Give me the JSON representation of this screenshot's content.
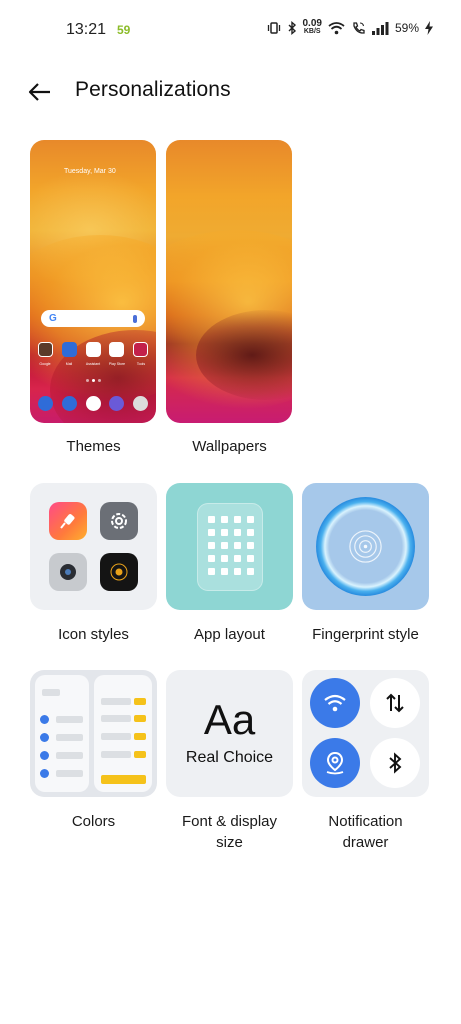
{
  "status_bar": {
    "time": "13:21",
    "badge": "59",
    "net_speed_value": "0.09",
    "net_speed_unit": "KB/S",
    "battery": "59%",
    "icons": [
      "vibrate-icon",
      "bluetooth-icon",
      "wifi-icon",
      "wifi-calling-icon",
      "signal-icon",
      "battery-charging-icon"
    ]
  },
  "header": {
    "title": "Personalizations",
    "back_icon": "arrow-left-icon"
  },
  "theme_preview": {
    "date": "Tuesday, Mar 30",
    "app_labels": [
      "Google",
      "Mail",
      "Assistant",
      "Play Store",
      "Tools"
    ]
  },
  "items": {
    "themes": "Themes",
    "wallpapers": "Wallpapers",
    "icon_styles": "Icon styles",
    "app_layout": "App layout",
    "fingerprint_style": "Fingerprint style",
    "colors": "Colors",
    "font_line1": "Font & display",
    "font_line2": "size",
    "notif_line1": "Notification",
    "notif_line2": "drawer"
  },
  "font_preview": {
    "sample": "Aa",
    "sample_text": "Real Choice"
  },
  "colors": {
    "accent_blue": "#3b7ae8",
    "accent_yellow": "#f5c21a",
    "layout_teal": "#8ed6d3",
    "fingerprint_bg": "#a6c8ea"
  }
}
